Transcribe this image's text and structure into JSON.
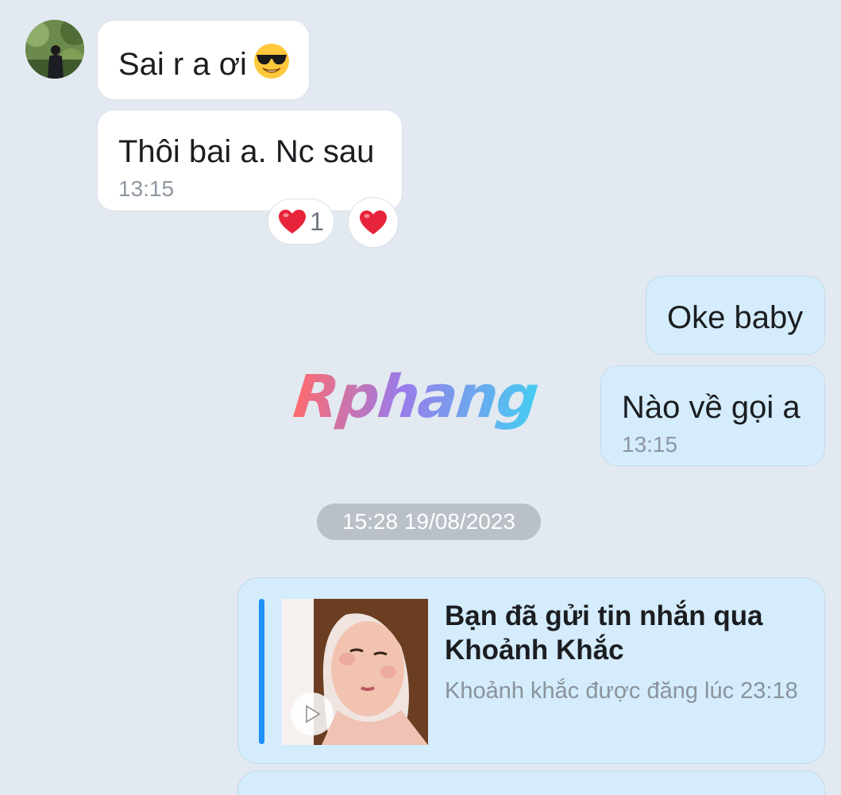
{
  "messages": [
    {
      "direction": "in",
      "text": "Sai r a ơi",
      "emoji": "smiling-face-with-sunglasses"
    },
    {
      "direction": "in",
      "text": "Thôi bai a. Nc sau",
      "time": "13:15",
      "reactions": [
        {
          "emoji": "red-heart",
          "count": "1"
        },
        {
          "emoji": "red-heart"
        }
      ]
    },
    {
      "direction": "out",
      "text": "Oke baby"
    },
    {
      "direction": "out",
      "text": "Nào về gọi a",
      "time": "13:15"
    }
  ],
  "watermark": "Rphang",
  "date_separator": "15:28 19/08/2023",
  "moment_card": {
    "title": "Bạn đã gửi tin nhắn qua Khoảnh Khắc",
    "subtitle": "Khoảnh khắc được đăng lúc 23:18",
    "accent_color": "#1e90ff",
    "icon": "play-icon"
  },
  "colors": {
    "background": "#e2e9f1",
    "incoming_bubble": "#ffffff",
    "outgoing_bubble": "#d4ecfb",
    "date_pill": "#b9c0c8"
  }
}
